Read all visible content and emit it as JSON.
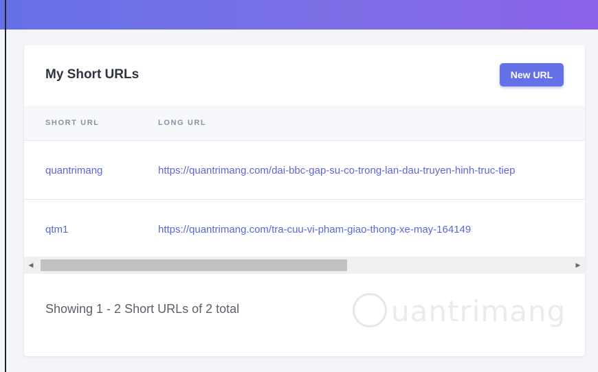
{
  "card": {
    "title": "My Short URLs",
    "new_button_label": "New URL"
  },
  "table": {
    "columns": [
      "SHORT URL",
      "LONG URL"
    ],
    "rows": [
      {
        "short": "quantrimang",
        "long": "https://quantrimang.com/dai-bbc-gap-su-co-trong-lan-dau-truyen-hinh-truc-tiep"
      },
      {
        "short": "qtm1",
        "long": "https://quantrimang.com/tra-cuu-vi-pham-giao-thong-xe-may-164149"
      }
    ]
  },
  "footer": {
    "summary": "Showing 1 - 2 Short URLs of 2 total"
  },
  "watermark": {
    "text": "uantrimang"
  },
  "colors": {
    "accent": "#6470e5",
    "link": "#5b66d6",
    "header_gradient_start": "#6570e6",
    "header_gradient_end": "#8b62e8"
  },
  "icons": {
    "scroll_left": "left-arrow",
    "scroll_right": "right-arrow"
  }
}
